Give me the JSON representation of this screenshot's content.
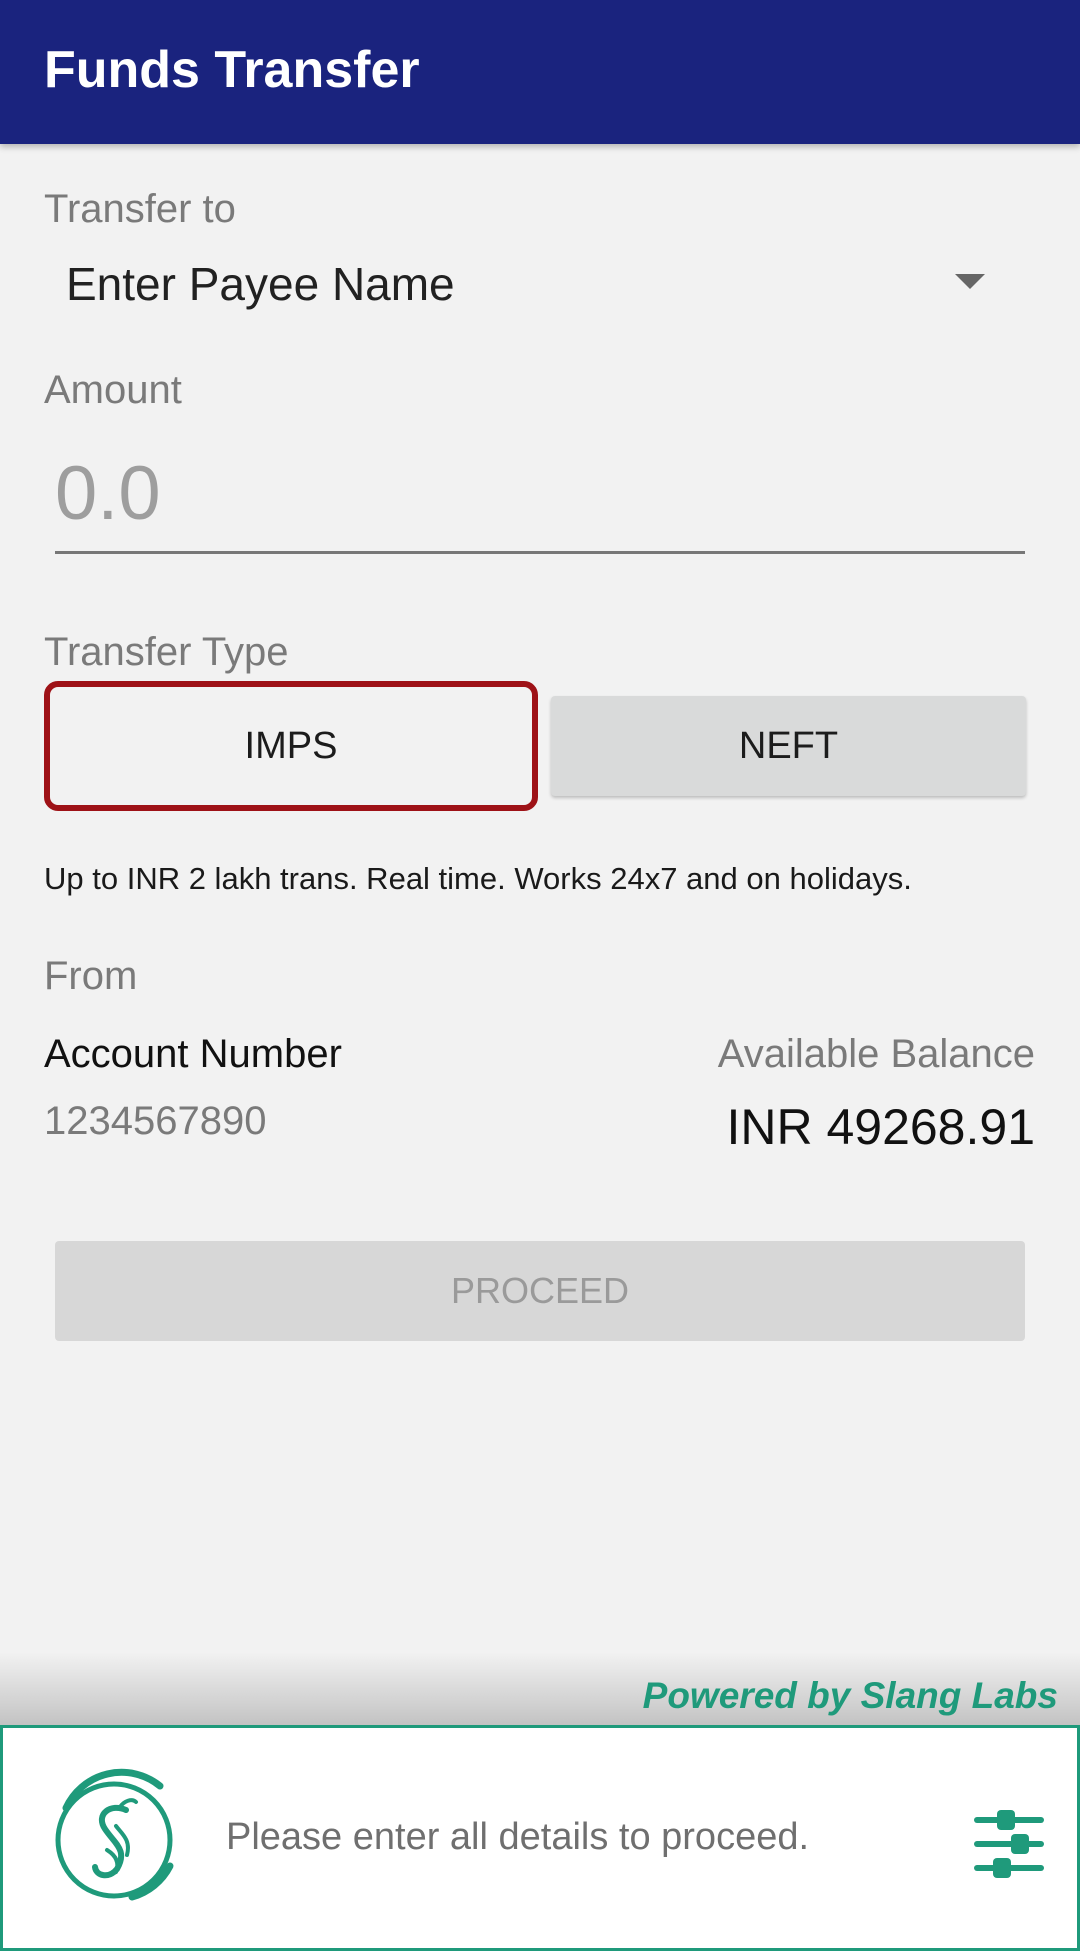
{
  "app_bar": {
    "title": "Funds Transfer",
    "color": "#1a237e"
  },
  "transfer_to": {
    "label": "Transfer to",
    "payee_placeholder": "Enter Payee Name",
    "icon": "chevron-down-icon"
  },
  "amount": {
    "label": "Amount",
    "placeholder": "0.0",
    "value": ""
  },
  "transfer_type": {
    "label": "Transfer Type",
    "options": [
      {
        "label": "IMPS",
        "selected": true
      },
      {
        "label": "NEFT",
        "selected": false
      }
    ],
    "selected_border_color": "#9e1217",
    "description": "Up to INR 2 lakh trans. Real time. Works 24x7 and on holidays."
  },
  "from": {
    "label": "From",
    "account_label": "Account Number",
    "account_number": "1234567890",
    "balance_label": "Available Balance",
    "balance_value": "INR 49268.91"
  },
  "proceed": {
    "label": "PROCEED",
    "enabled": false
  },
  "assistant": {
    "powered_by": "Powered by Slang Labs",
    "prompt": "Please enter all details to proceed.",
    "accent_color": "#1f9a7b",
    "logo_icon": "slang-logo-icon",
    "settings_icon": "sliders-icon"
  }
}
